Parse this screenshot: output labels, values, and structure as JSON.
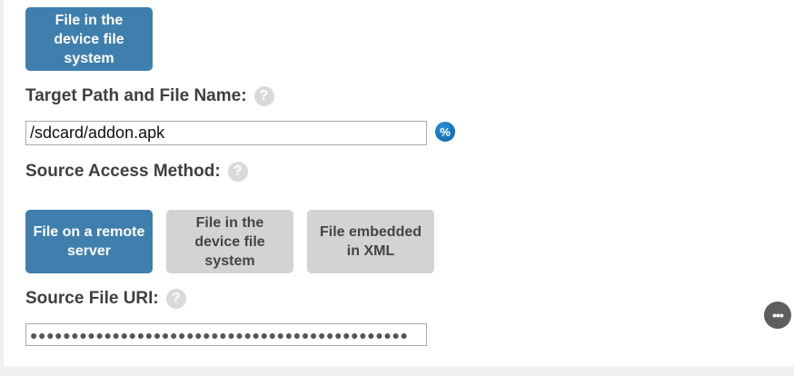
{
  "top_button": {
    "label": "File in the device file system"
  },
  "target_path": {
    "label": "Target Path and File Name:",
    "help_icon": "?",
    "value": "/sdcard/addon.apk",
    "variable_icon": "%"
  },
  "source_access": {
    "label": "Source Access Method:",
    "help_icon": "?",
    "options": [
      {
        "label": "File on a remote server",
        "selected": true
      },
      {
        "label": "File in the device file system",
        "selected": false
      },
      {
        "label": "File embedded in XML",
        "selected": false
      }
    ]
  },
  "source_uri": {
    "label": "Source File URI:",
    "help_icon": "?",
    "masked_value": "●●●●●●●●●●●●●●●●●●●●●●●●●●●●●●●●●●●●●●●●●●●●●●"
  },
  "more_button": {
    "icon": "•••"
  },
  "colors": {
    "selected_button": "#3f7fad",
    "unselected_button": "#d3d3d3",
    "label_text": "#3f3f3f",
    "page_background": "#f0f0f0"
  }
}
